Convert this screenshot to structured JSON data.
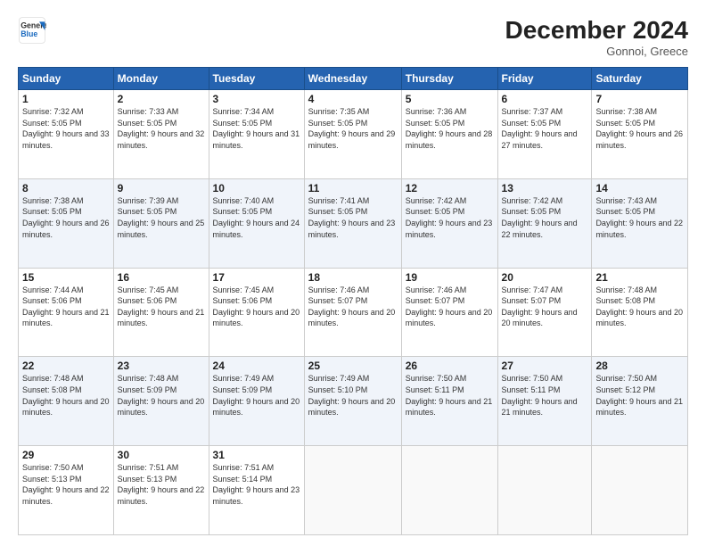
{
  "logo": {
    "line1": "General",
    "line2": "Blue"
  },
  "title": "December 2024",
  "location": "Gonnoi, Greece",
  "headers": [
    "Sunday",
    "Monday",
    "Tuesday",
    "Wednesday",
    "Thursday",
    "Friday",
    "Saturday"
  ],
  "weeks": [
    [
      {
        "day": "1",
        "sunrise": "7:32 AM",
        "sunset": "5:05 PM",
        "daylight": "9 hours and 33 minutes."
      },
      {
        "day": "2",
        "sunrise": "7:33 AM",
        "sunset": "5:05 PM",
        "daylight": "9 hours and 32 minutes."
      },
      {
        "day": "3",
        "sunrise": "7:34 AM",
        "sunset": "5:05 PM",
        "daylight": "9 hours and 31 minutes."
      },
      {
        "day": "4",
        "sunrise": "7:35 AM",
        "sunset": "5:05 PM",
        "daylight": "9 hours and 29 minutes."
      },
      {
        "day": "5",
        "sunrise": "7:36 AM",
        "sunset": "5:05 PM",
        "daylight": "9 hours and 28 minutes."
      },
      {
        "day": "6",
        "sunrise": "7:37 AM",
        "sunset": "5:05 PM",
        "daylight": "9 hours and 27 minutes."
      },
      {
        "day": "7",
        "sunrise": "7:38 AM",
        "sunset": "5:05 PM",
        "daylight": "9 hours and 26 minutes."
      }
    ],
    [
      {
        "day": "8",
        "sunrise": "7:38 AM",
        "sunset": "5:05 PM",
        "daylight": "9 hours and 26 minutes."
      },
      {
        "day": "9",
        "sunrise": "7:39 AM",
        "sunset": "5:05 PM",
        "daylight": "9 hours and 25 minutes."
      },
      {
        "day": "10",
        "sunrise": "7:40 AM",
        "sunset": "5:05 PM",
        "daylight": "9 hours and 24 minutes."
      },
      {
        "day": "11",
        "sunrise": "7:41 AM",
        "sunset": "5:05 PM",
        "daylight": "9 hours and 23 minutes."
      },
      {
        "day": "12",
        "sunrise": "7:42 AM",
        "sunset": "5:05 PM",
        "daylight": "9 hours and 23 minutes."
      },
      {
        "day": "13",
        "sunrise": "7:42 AM",
        "sunset": "5:05 PM",
        "daylight": "9 hours and 22 minutes."
      },
      {
        "day": "14",
        "sunrise": "7:43 AM",
        "sunset": "5:05 PM",
        "daylight": "9 hours and 22 minutes."
      }
    ],
    [
      {
        "day": "15",
        "sunrise": "7:44 AM",
        "sunset": "5:06 PM",
        "daylight": "9 hours and 21 minutes."
      },
      {
        "day": "16",
        "sunrise": "7:45 AM",
        "sunset": "5:06 PM",
        "daylight": "9 hours and 21 minutes."
      },
      {
        "day": "17",
        "sunrise": "7:45 AM",
        "sunset": "5:06 PM",
        "daylight": "9 hours and 20 minutes."
      },
      {
        "day": "18",
        "sunrise": "7:46 AM",
        "sunset": "5:07 PM",
        "daylight": "9 hours and 20 minutes."
      },
      {
        "day": "19",
        "sunrise": "7:46 AM",
        "sunset": "5:07 PM",
        "daylight": "9 hours and 20 minutes."
      },
      {
        "day": "20",
        "sunrise": "7:47 AM",
        "sunset": "5:07 PM",
        "daylight": "9 hours and 20 minutes."
      },
      {
        "day": "21",
        "sunrise": "7:48 AM",
        "sunset": "5:08 PM",
        "daylight": "9 hours and 20 minutes."
      }
    ],
    [
      {
        "day": "22",
        "sunrise": "7:48 AM",
        "sunset": "5:08 PM",
        "daylight": "9 hours and 20 minutes."
      },
      {
        "day": "23",
        "sunrise": "7:48 AM",
        "sunset": "5:09 PM",
        "daylight": "9 hours and 20 minutes."
      },
      {
        "day": "24",
        "sunrise": "7:49 AM",
        "sunset": "5:09 PM",
        "daylight": "9 hours and 20 minutes."
      },
      {
        "day": "25",
        "sunrise": "7:49 AM",
        "sunset": "5:10 PM",
        "daylight": "9 hours and 20 minutes."
      },
      {
        "day": "26",
        "sunrise": "7:50 AM",
        "sunset": "5:11 PM",
        "daylight": "9 hours and 21 minutes."
      },
      {
        "day": "27",
        "sunrise": "7:50 AM",
        "sunset": "5:11 PM",
        "daylight": "9 hours and 21 minutes."
      },
      {
        "day": "28",
        "sunrise": "7:50 AM",
        "sunset": "5:12 PM",
        "daylight": "9 hours and 21 minutes."
      }
    ],
    [
      {
        "day": "29",
        "sunrise": "7:50 AM",
        "sunset": "5:13 PM",
        "daylight": "9 hours and 22 minutes."
      },
      {
        "day": "30",
        "sunrise": "7:51 AM",
        "sunset": "5:13 PM",
        "daylight": "9 hours and 22 minutes."
      },
      {
        "day": "31",
        "sunrise": "7:51 AM",
        "sunset": "5:14 PM",
        "daylight": "9 hours and 23 minutes."
      },
      null,
      null,
      null,
      null
    ]
  ],
  "labels": {
    "sunrise": "Sunrise:",
    "sunset": "Sunset:",
    "daylight": "Daylight:"
  }
}
